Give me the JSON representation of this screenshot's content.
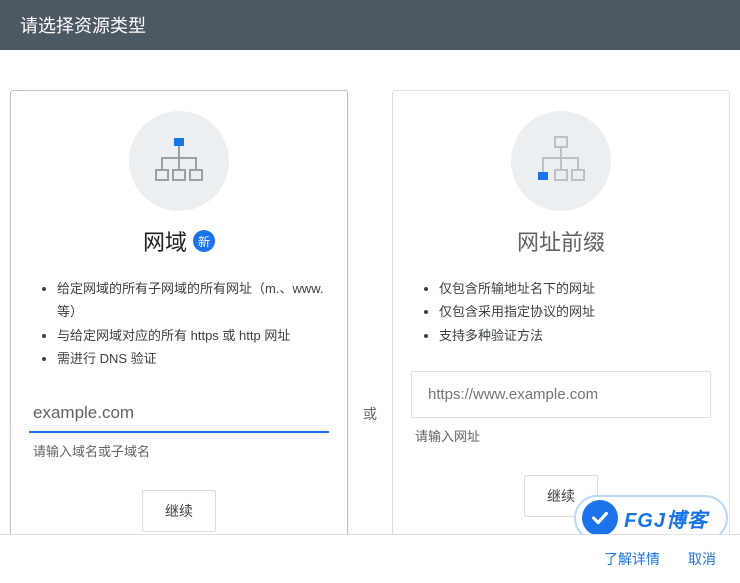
{
  "header": {
    "title": "请选择资源类型"
  },
  "separator": "或",
  "cards": {
    "domain": {
      "title": "网域",
      "badge": "新",
      "bullets": [
        "给定网域的所有子网域的所有网址（m.、www. 等）",
        "与给定网域对应的所有 https 或 http 网址",
        "需进行 DNS 验证"
      ],
      "inputValue": "example.com",
      "helper": "请输入域名或子域名",
      "button": "继续"
    },
    "prefix": {
      "title": "网址前缀",
      "bullets": [
        "仅包含所输地址名下的网址",
        "仅包含采用指定协议的网址",
        "支持多种验证方法"
      ],
      "placeholder": "https://www.example.com",
      "helper": "请输入网址",
      "button": "继续"
    }
  },
  "footer": {
    "more": "了解详情",
    "cancel": "取消"
  },
  "watermark": {
    "text": "FGJ博客"
  }
}
